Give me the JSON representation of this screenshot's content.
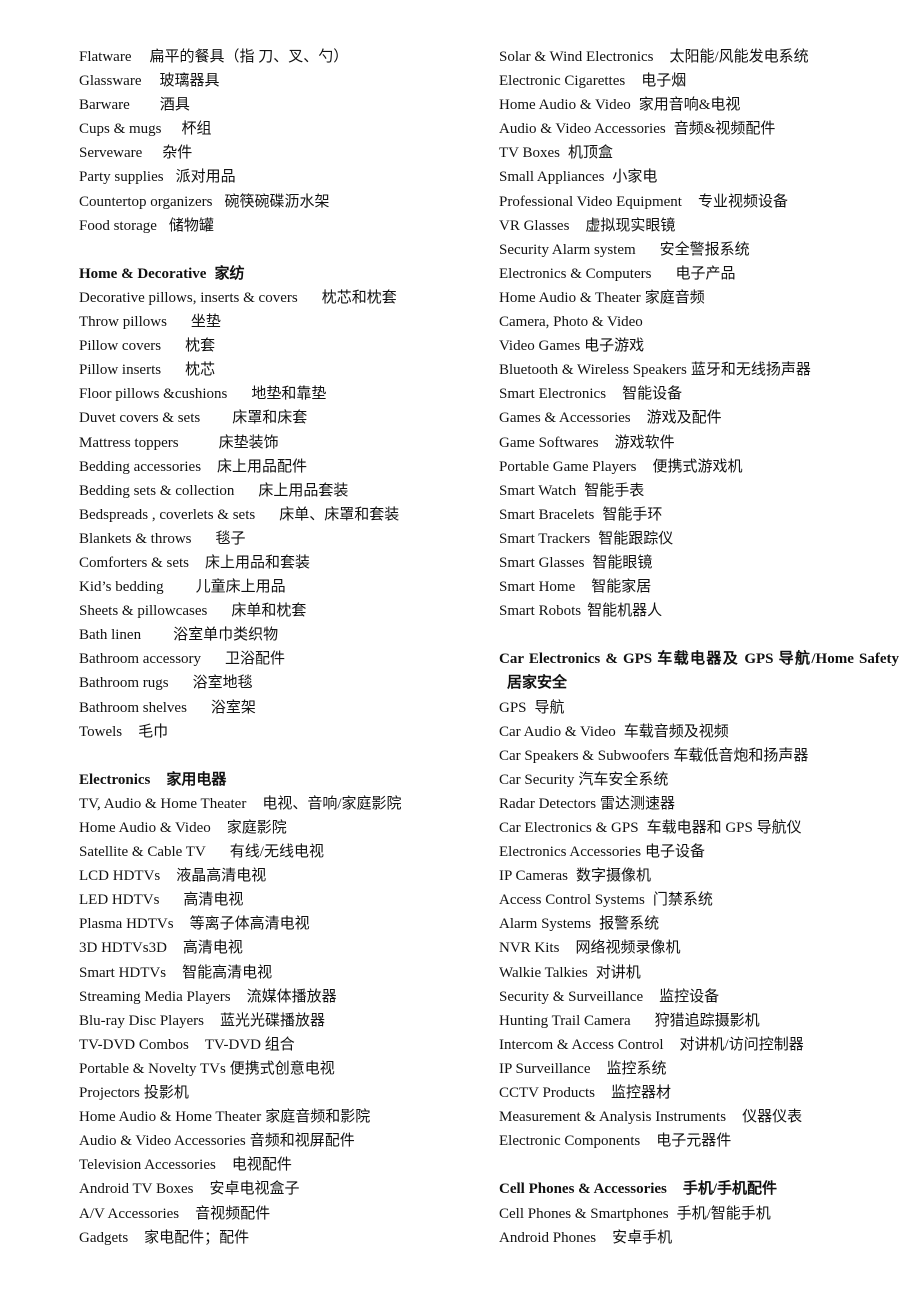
{
  "left_column": [
    {
      "type": "item",
      "en": "Flatware",
      "zh": "扁平的餐具（指  刀、叉、勺）",
      "gap": 18
    },
    {
      "type": "item",
      "en": "Glassware",
      "zh": "玻璃器具",
      "gap": 18
    },
    {
      "type": "item",
      "en": "Barware",
      "zh": "酒具",
      "gap": 30
    },
    {
      "type": "item",
      "en": "Cups & mugs",
      "zh": "杯组",
      "gap": 20
    },
    {
      "type": "item",
      "en": "Serveware",
      "zh": "杂件",
      "gap": 20
    },
    {
      "type": "item",
      "en": "Party supplies",
      "zh": "派对用品",
      "gap": 12
    },
    {
      "type": "item",
      "en": "Countertop organizers",
      "zh": "碗筷碗碟沥水架",
      "gap": 12
    },
    {
      "type": "item",
      "en": "Food storage",
      "zh": "储物罐",
      "gap": 12
    },
    {
      "type": "gap"
    },
    {
      "type": "heading",
      "en": "Home & Decorative",
      "zh": "家纺",
      "gap": 8
    },
    {
      "type": "item",
      "en": "Decorative pillows, inserts & covers",
      "zh": "枕芯和枕套",
      "gap": 24
    },
    {
      "type": "item",
      "en": "Throw pillows",
      "zh": "坐垫",
      "gap": 24
    },
    {
      "type": "item",
      "en": "Pillow covers",
      "zh": "枕套",
      "gap": 24
    },
    {
      "type": "item",
      "en": "Pillow inserts",
      "zh": "枕芯",
      "gap": 24
    },
    {
      "type": "item",
      "en": "Floor pillows &cushions",
      "zh": "地垫和靠垫",
      "gap": 24
    },
    {
      "type": "item",
      "en": "Duvet covers & sets",
      "zh": "床罩和床套",
      "gap": 32
    },
    {
      "type": "item",
      "en": "Mattress toppers",
      "zh": "床垫装饰",
      "gap": 40
    },
    {
      "type": "item",
      "en": "Bedding accessories",
      "zh": "床上用品配件",
      "gap": 16
    },
    {
      "type": "item",
      "en": "Bedding sets & collection",
      "zh": "床上用品套装",
      "gap": 24
    },
    {
      "type": "item",
      "en": "Bedspreads , coverlets & sets",
      "zh": "床单、床罩和套装",
      "gap": 24
    },
    {
      "type": "item",
      "en": "Blankets & throws",
      "zh": "毯子",
      "gap": 24
    },
    {
      "type": "item",
      "en": "Comforters & sets",
      "zh": "床上用品和套装",
      "gap": 16
    },
    {
      "type": "item",
      "en": "Kid’s bedding",
      "zh": "儿童床上用品",
      "gap": 32
    },
    {
      "type": "item",
      "en": "Sheets & pillowcases",
      "zh": "床单和枕套",
      "gap": 24
    },
    {
      "type": "item",
      "en": "Bath linen",
      "zh": "浴室单巾类织物",
      "gap": 32
    },
    {
      "type": "item",
      "en": "Bathroom accessory",
      "zh": "卫浴配件",
      "gap": 24
    },
    {
      "type": "item",
      "en": "Bathroom rugs",
      "zh": "浴室地毯",
      "gap": 24
    },
    {
      "type": "item",
      "en": "Bathroom shelves",
      "zh": "浴室架",
      "gap": 24
    },
    {
      "type": "item",
      "en": "Towels",
      "zh": "毛巾",
      "gap": 16
    },
    {
      "type": "gap"
    },
    {
      "type": "heading",
      "en": "Electronics",
      "zh": "家用电器",
      "gap": 16
    },
    {
      "type": "item",
      "en": "TV, Audio & Home Theater",
      "zh": "电视、音响/家庭影院",
      "gap": 16
    },
    {
      "type": "item",
      "en": "Home Audio & Video",
      "zh": "家庭影院",
      "gap": 16
    },
    {
      "type": "item",
      "en": "Satellite & Cable TV",
      "zh": "有线/无线电视",
      "gap": 24
    },
    {
      "type": "item",
      "en": "LCD HDTVs",
      "zh": "液晶高清电视",
      "gap": 16
    },
    {
      "type": "item",
      "en": "LED HDTVs",
      "zh": "高清电视",
      "gap": 24
    },
    {
      "type": "item",
      "en": "Plasma HDTVs",
      "zh": "等离子体高清电视",
      "gap": 16
    },
    {
      "type": "item",
      "en": "3D HDTVs3D",
      "zh": "高清电视",
      "gap": 16
    },
    {
      "type": "item",
      "en": "Smart HDTVs",
      "zh": "智能高清电视",
      "gap": 16
    },
    {
      "type": "item",
      "en": "Streaming Media Players",
      "zh": "流媒体播放器",
      "gap": 16
    },
    {
      "type": "item",
      "en": "Blu-ray Disc Players",
      "zh": "蓝光光碟播放器",
      "gap": 16
    },
    {
      "type": "item",
      "en": "TV-DVD Combos",
      "zh": "TV-DVD 组合",
      "gap": 16
    },
    {
      "type": "item",
      "en": "Portable & Novelty TVs",
      "zh": "便携式创意电视",
      "gap": 4
    },
    {
      "type": "item",
      "en": "Projectors",
      "zh": "投影机",
      "gap": 4
    },
    {
      "type": "item",
      "en": "Home Audio & Home Theater",
      "zh": "家庭音频和影院",
      "gap": 4
    },
    {
      "type": "item",
      "en": "Audio & Video Accessories",
      "zh": "音频和视屏配件",
      "gap": 4
    },
    {
      "type": "item",
      "en": "Television Accessories",
      "zh": "电视配件",
      "gap": 16
    },
    {
      "type": "item",
      "en": "Android TV Boxes",
      "zh": "安卓电视盒子",
      "gap": 16
    },
    {
      "type": "item",
      "en": "A/V Accessories",
      "zh": "音视频配件",
      "gap": 16
    },
    {
      "type": "item",
      "en": "Gadgets",
      "zh": "家电配件；配件",
      "gap": 16
    }
  ],
  "right_column": [
    {
      "type": "item",
      "en": "Solar & Wind Electronics",
      "zh": "太阳能/风能发电系统",
      "gap": 16
    },
    {
      "type": "item",
      "en": "Electronic Cigarettes",
      "zh": "电子烟",
      "gap": 16
    },
    {
      "type": "item",
      "en": "Home Audio & Video",
      "zh": "家用音响&电视",
      "gap": 8
    },
    {
      "type": "item",
      "en": "Audio & Video Accessories",
      "zh": "音频&视频配件",
      "gap": 8
    },
    {
      "type": "item",
      "en": "TV Boxes",
      "zh": "机顶盒",
      "gap": 8
    },
    {
      "type": "item",
      "en": "Small Appliances",
      "zh": "小家电",
      "gap": 8
    },
    {
      "type": "item",
      "en": "Professional Video Equipment",
      "zh": "专业视频设备",
      "gap": 16
    },
    {
      "type": "item",
      "en": "VR Glasses",
      "zh": "虚拟现实眼镜",
      "gap": 16
    },
    {
      "type": "item",
      "en": "Security Alarm system",
      "zh": "安全警报系统",
      "gap": 24
    },
    {
      "type": "item",
      "en": "Electronics & Computers",
      "zh": "电子产品",
      "gap": 24
    },
    {
      "type": "item",
      "en": "Home Audio & Theater",
      "zh": "家庭音频",
      "gap": 4
    },
    {
      "type": "item",
      "en": "Camera, Photo & Video",
      "zh": "",
      "gap": 4
    },
    {
      "type": "item",
      "en": "Video Games",
      "zh": "电子游戏",
      "gap": 4
    },
    {
      "type": "item",
      "en": "Bluetooth & Wireless Speakers",
      "zh": "蓝牙和无线扬声器",
      "gap": 4
    },
    {
      "type": "item",
      "en": "Smart Electronics",
      "zh": "智能设备",
      "gap": 16
    },
    {
      "type": "item",
      "en": "Games & Accessories",
      "zh": "游戏及配件",
      "gap": 16
    },
    {
      "type": "item",
      "en": "Game Softwares",
      "zh": "游戏软件",
      "gap": 16
    },
    {
      "type": "item",
      "en": "Portable Game Players",
      "zh": "便携式游戏机",
      "gap": 16
    },
    {
      "type": "item",
      "en": "Smart Watch",
      "zh": "智能手表",
      "gap": 8
    },
    {
      "type": "item",
      "en": "Smart Bracelets",
      "zh": "智能手环",
      "gap": 8
    },
    {
      "type": "item",
      "en": "Smart Trackers",
      "zh": "智能跟踪仪",
      "gap": 8
    },
    {
      "type": "item",
      "en": "Smart Glasses",
      "zh": "智能眼镜",
      "gap": 8
    },
    {
      "type": "item",
      "en": "Smart Home",
      "zh": "智能家居",
      "gap": 16
    },
    {
      "type": "item",
      "en": "Smart Robots",
      "zh": "智能机器人",
      "gap": 6
    },
    {
      "type": "gap"
    },
    {
      "type": "heading-wrap",
      "en": "Car Electronics & GPS 车载电器及 GPS 导航/Home Safety",
      "zh": "居家安全"
    },
    {
      "type": "item",
      "en": "GPS",
      "zh": "导航",
      "gap": 8
    },
    {
      "type": "item",
      "en": "Car Audio & Video",
      "zh": "车载音频及视频",
      "gap": 8
    },
    {
      "type": "item",
      "en": "Car Speakers & Subwoofers",
      "zh": "车载低音炮和扬声器",
      "gap": 4
    },
    {
      "type": "item",
      "en": "Car Security",
      "zh": "汽车安全系统",
      "gap": 4
    },
    {
      "type": "item",
      "en": "Radar Detectors",
      "zh": "雷达测速器",
      "gap": 4
    },
    {
      "type": "item",
      "en": "Car Electronics & GPS",
      "zh": "车载电器和 GPS 导航仪",
      "gap": 8
    },
    {
      "type": "item",
      "en": "Electronics Accessories",
      "zh": "电子设备",
      "gap": 4
    },
    {
      "type": "item",
      "en": "IP Cameras",
      "zh": "数字摄像机",
      "gap": 8
    },
    {
      "type": "item",
      "en": "Access Control Systems",
      "zh": "门禁系统",
      "gap": 8
    },
    {
      "type": "item",
      "en": "Alarm Systems",
      "zh": "报警系统",
      "gap": 8
    },
    {
      "type": "item",
      "en": "NVR Kits",
      "zh": "网络视频录像机",
      "gap": 16
    },
    {
      "type": "item",
      "en": "Walkie Talkies",
      "zh": "对讲机",
      "gap": 8
    },
    {
      "type": "item",
      "en": "Security & Surveillance",
      "zh": "监控设备",
      "gap": 16
    },
    {
      "type": "item",
      "en": "Hunting Trail Camera",
      "zh": "狩猎追踪摄影机",
      "gap": 24
    },
    {
      "type": "item",
      "en": "Intercom & Access Control",
      "zh": "对讲机/访问控制器",
      "gap": 16
    },
    {
      "type": "item",
      "en": "IP Surveillance",
      "zh": "监控系统",
      "gap": 16
    },
    {
      "type": "item",
      "en": "CCTV Products",
      "zh": "监控器材",
      "gap": 16
    },
    {
      "type": "item",
      "en": "Measurement & Analysis Instruments",
      "zh": "仪器仪表",
      "gap": 16
    },
    {
      "type": "item",
      "en": "Electronic Components",
      "zh": "电子元器件",
      "gap": 16
    },
    {
      "type": "gap"
    },
    {
      "type": "heading",
      "en": "Cell Phones & Accessories",
      "zh": "手机/手机配件",
      "gap": 16
    },
    {
      "type": "item",
      "en": "Cell Phones & Smartphones",
      "zh": "手机/智能手机",
      "gap": 8
    },
    {
      "type": "item",
      "en": "Android Phones",
      "zh": "安卓手机",
      "gap": 16
    }
  ]
}
